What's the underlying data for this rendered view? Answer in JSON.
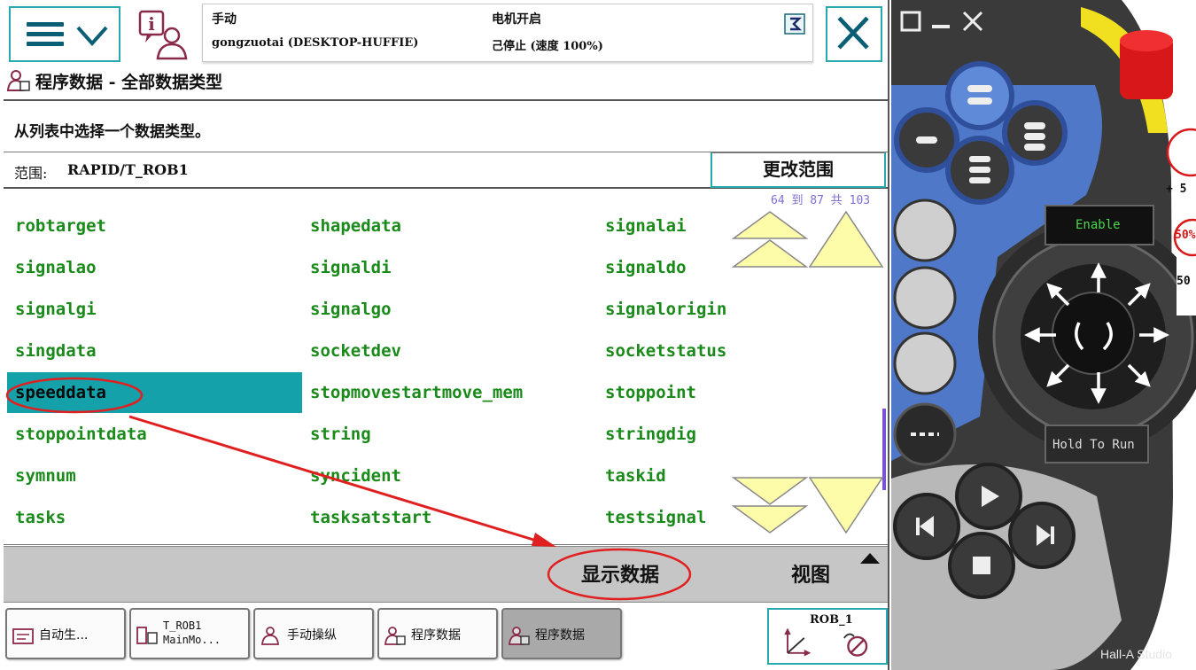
{
  "status": {
    "mode": "手动",
    "controller": "gongzuotai (DESKTOP-HUFFIE)",
    "motor": "电机开启",
    "state": "己停止 (速度 100%)"
  },
  "title": "程序数据 - 全部数据类型",
  "instruction": "从列表中选择一个数据类型。",
  "scope": {
    "label": "范围:",
    "value": "RAPID/T_ROB1",
    "change_button": "更改范围"
  },
  "counter": "64 到 87 共 103",
  "items": [
    "robtarget",
    "shapedata",
    "signalai",
    "signalao",
    "signaldi",
    "signaldo",
    "signalgi",
    "signalgo",
    "signalorigin",
    "singdata",
    "socketdev",
    "socketstatus",
    "speeddata",
    "stopmovestartmove_mem",
    "stoppoint",
    "stoppointdata",
    "string",
    "stringdig",
    "symnum",
    "syncident",
    "taskid",
    "tasks",
    "tasksatstart",
    "testsignal"
  ],
  "selected_item": "speeddata",
  "commands": {
    "show_data": "显示数据",
    "view": "视图"
  },
  "taskbar": {
    "t1": "自动生...",
    "t2_line1": "T_ROB1",
    "t2_line2": "MainMo...",
    "t3": "手动操纵",
    "t4": "程序数据",
    "t5": "程序数据",
    "rob": "ROB_1"
  },
  "device": {
    "enable": "Enable",
    "hold_to_run": "Hold To Run",
    "speed_plus": "+ 5",
    "speed_50": "50",
    "speed_50_top": "50%"
  },
  "watermark": "Hall-A Studio",
  "colors": {
    "accent": "#2aa8b0",
    "item_text": "#1a8a1a",
    "selected_bg": "#14a1a9",
    "annotation": "#e02020",
    "scroll_arrow": "#fdfca8",
    "device_body": "#3a3a3a",
    "device_blue": "#4f79c8"
  }
}
